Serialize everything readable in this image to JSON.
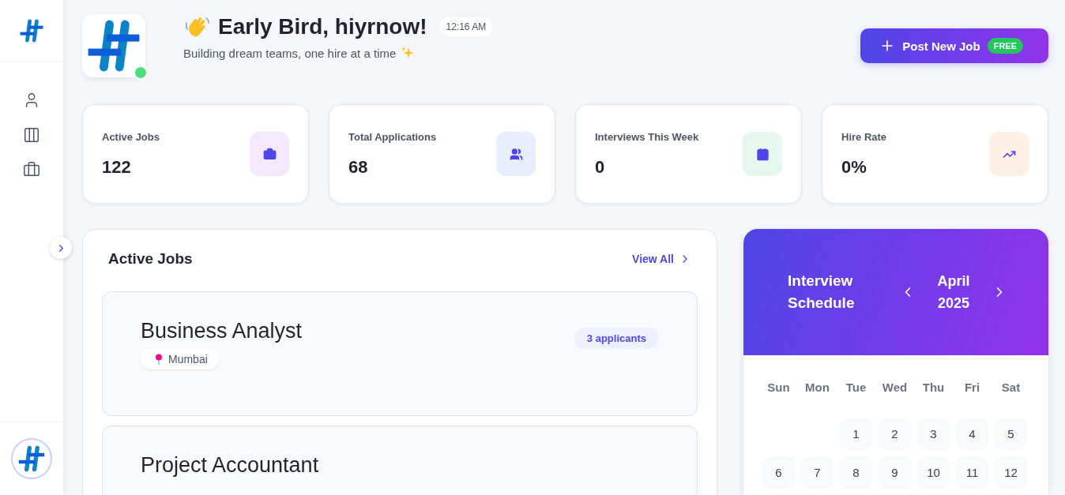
{
  "sidebar": {
    "items": [
      {
        "kind": "profile",
        "selected": false
      },
      {
        "kind": "board",
        "selected": false
      },
      {
        "kind": "jobs",
        "selected": false
      }
    ]
  },
  "header": {
    "greeting": "Early Bird, hiyrnow!",
    "time": "12:16 AM",
    "subtitle": "Building dream teams, one hire at a time",
    "online": true,
    "post_button": {
      "label": "Post New Job",
      "badge": "FREE"
    }
  },
  "stats": [
    {
      "kind": "jobs",
      "label": "Active Jobs",
      "value": "122",
      "color": "#f3e8ff"
    },
    {
      "kind": "applications",
      "label": "Total Applications",
      "value": "68",
      "color": "#e8eefe"
    },
    {
      "kind": "interviews",
      "label": "Interviews This Week",
      "value": "0",
      "color": "#e6f7ee"
    },
    {
      "kind": "rate",
      "label": "Hire Rate",
      "value": "0%",
      "color": "#fdf0e6"
    }
  ],
  "active_jobs": {
    "title": "Active Jobs",
    "view_all": "View All",
    "jobs": [
      {
        "title": "Business Analyst",
        "location": "Mumbai",
        "applicants": "3 applicants"
      },
      {
        "title": "Project Accountant"
      }
    ]
  },
  "schedule": {
    "title": "Interview Schedule",
    "month": "April",
    "year": "2025",
    "weekdays": [
      "Sun",
      "Mon",
      "Tue",
      "Wed",
      "Thu",
      "Fri",
      "Sat"
    ],
    "days": [
      {
        "kind": "blank"
      },
      {
        "kind": "blank"
      },
      {
        "kind": "day",
        "label": "1"
      },
      {
        "kind": "day",
        "label": "2"
      },
      {
        "kind": "day",
        "label": "3"
      },
      {
        "kind": "day",
        "label": "4"
      },
      {
        "kind": "day",
        "label": "5"
      },
      {
        "kind": "day",
        "label": "6"
      },
      {
        "kind": "day",
        "label": "7"
      },
      {
        "kind": "day",
        "label": "8"
      },
      {
        "kind": "day",
        "label": "9"
      },
      {
        "kind": "day",
        "label": "10"
      },
      {
        "kind": "day",
        "label": "11"
      },
      {
        "kind": "day",
        "label": "12"
      }
    ]
  }
}
